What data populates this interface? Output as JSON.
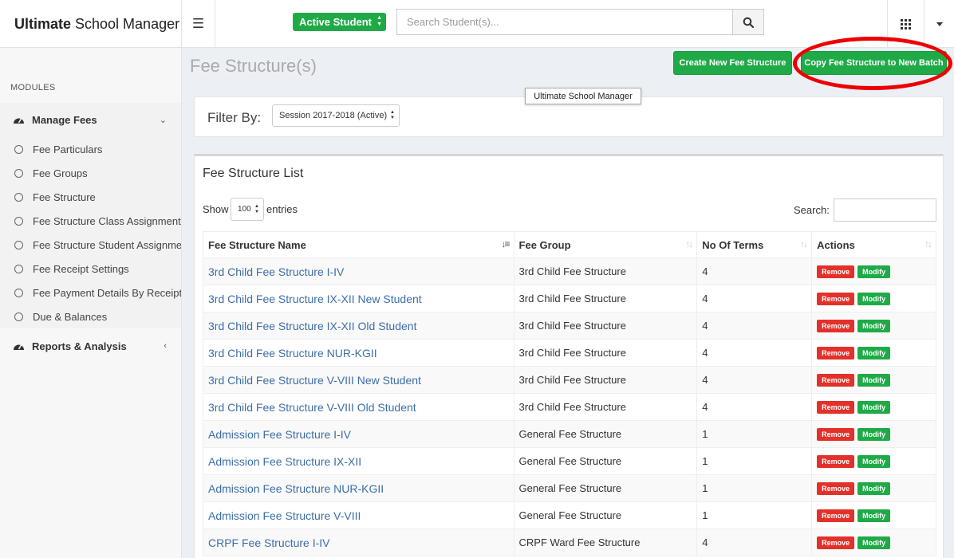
{
  "app": {
    "brand_bold": "Ultimate",
    "brand_rest": "School Manager"
  },
  "header": {
    "student_filter": "Active Student",
    "search_placeholder": "Search Student(s)..."
  },
  "sidebar": {
    "modules_label": "MODULES",
    "manage_fees": "Manage Fees",
    "items": [
      "Fee Particulars",
      "Fee Groups",
      "Fee Structure",
      "Fee Structure Class Assignment",
      "Fee Structure Student Assignment",
      "Fee Receipt Settings",
      "Fee Payment Details By Receipt No",
      "Due & Balances"
    ],
    "reports": "Reports & Analysis"
  },
  "page": {
    "title": "Fee Structure(s)",
    "create_btn": "Create New Fee Structure",
    "copy_btn": "Copy Fee Structure to New Batch",
    "tooltip": "Ultimate School Manager"
  },
  "filter": {
    "label": "Filter By:",
    "session": "Session 2017-2018 (Active)"
  },
  "list": {
    "title": "Fee Structure List",
    "show": "Show",
    "length": "100",
    "entries": "entries",
    "search_label": "Search:",
    "columns": [
      "Fee Structure Name",
      "Fee Group",
      "No Of Terms",
      "Actions"
    ],
    "remove_label": "Remove",
    "modify_label": "Modify",
    "rows": [
      {
        "name": "3rd Child Fee Structure I-IV",
        "group": "3rd Child Fee Structure",
        "terms": "4"
      },
      {
        "name": "3rd Child Fee Structure IX-XII New Student",
        "group": "3rd Child Fee Structure",
        "terms": "4"
      },
      {
        "name": "3rd Child Fee Structure IX-XII Old Student",
        "group": "3rd Child Fee Structure",
        "terms": "4"
      },
      {
        "name": "3rd Child Fee Structure NUR-KGII",
        "group": "3rd Child Fee Structure",
        "terms": "4"
      },
      {
        "name": "3rd Child Fee Structure V-VIII New Student",
        "group": "3rd Child Fee Structure",
        "terms": "4"
      },
      {
        "name": "3rd Child Fee Structure V-VIII Old Student",
        "group": "3rd Child Fee Structure",
        "terms": "4"
      },
      {
        "name": "Admission Fee Structure I-IV",
        "group": "General Fee Structure",
        "terms": "1"
      },
      {
        "name": "Admission Fee Structure IX-XII",
        "group": "General Fee Structure",
        "terms": "1"
      },
      {
        "name": "Admission Fee Structure NUR-KGII",
        "group": "General Fee Structure",
        "terms": "1"
      },
      {
        "name": "Admission Fee Structure V-VIII",
        "group": "General Fee Structure",
        "terms": "1"
      },
      {
        "name": "CRPF Fee Structure I-IV",
        "group": "CRPF Ward Fee Structure",
        "terms": "4"
      }
    ]
  }
}
